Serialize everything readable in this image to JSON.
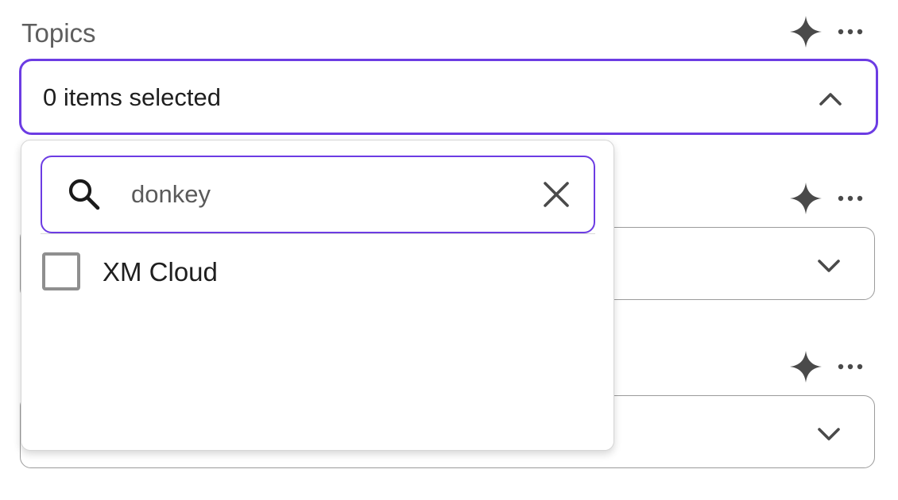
{
  "fields": [
    {
      "label": "Topics",
      "value": "0 items selected",
      "expanded": true,
      "actions": {
        "ai_icon": "sparkle-icon",
        "more_icon": "more-horizontal-icon"
      }
    },
    {
      "label": "",
      "value": "",
      "expanded": false,
      "actions": {
        "ai_icon": "sparkle-icon",
        "more_icon": "more-horizontal-icon"
      }
    },
    {
      "label": "",
      "value": "",
      "expanded": false,
      "actions": {
        "ai_icon": "sparkle-icon",
        "more_icon": "more-horizontal-icon"
      }
    }
  ],
  "dropdown": {
    "search": {
      "value": "donkey",
      "icon": "search-icon",
      "clear_icon": "close-icon"
    },
    "options": [
      {
        "label": "XM Cloud",
        "checked": false
      }
    ]
  },
  "colors": {
    "accent": "#6c3ce3",
    "icon": "#4a4a4a",
    "border": "#9b9b9b"
  }
}
